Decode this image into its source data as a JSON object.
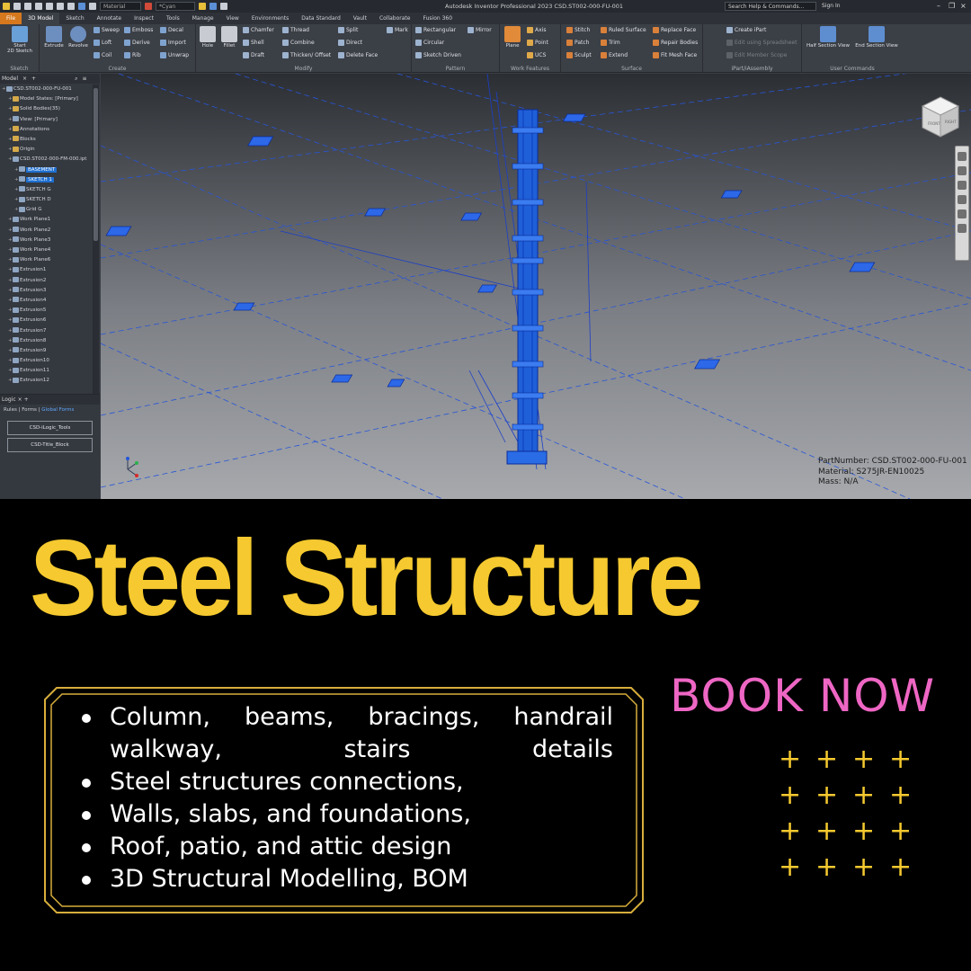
{
  "app": {
    "window_title": "Autodesk Inventor Professional 2023   CSD.ST002-000-FU-001",
    "material_field": "Material",
    "appearance_field": "*Cyan",
    "search_placeholder": "Search Help & Commands...",
    "sign_in": "Sign In",
    "tabs": [
      "File",
      "3D Model",
      "Sketch",
      "Annotate",
      "Inspect",
      "Tools",
      "Manage",
      "View",
      "Environments",
      "Data Standard",
      "Vault",
      "Collaborate",
      "Fusion 360"
    ],
    "active_tab": "3D Model",
    "ribbon": {
      "sketch": {
        "label": "Sketch",
        "start": "Start\n2D Sketch"
      },
      "create": {
        "label": "Create",
        "extrude": "Extrude",
        "revolve": "Revolve",
        "sweep": "Sweep",
        "loft": "Loft",
        "coil": "Coil",
        "emboss": "Emboss",
        "derive": "Derive",
        "rib": "Rib",
        "decal": "Decal",
        "import": "Import",
        "unwrap": "Unwrap"
      },
      "modify": {
        "label": "Modify",
        "hole": "Hole",
        "fillet": "Fillet",
        "chamfer": "Chamfer",
        "shell": "Shell",
        "draft": "Draft",
        "thread": "Thread",
        "combine": "Combine",
        "thicken": "Thicken/ Offset",
        "split": "Split",
        "direct": "Direct",
        "delete_face": "Delete Face"
      },
      "pattern": {
        "label": "Pattern",
        "mark": "Mark",
        "rectangular": "Rectangular",
        "circular": "Circular",
        "sketch_driven": "Sketch Driven",
        "mirror": "Mirror"
      },
      "work_features": {
        "label": "Work Features",
        "plane": "Plane",
        "axis": "Axis",
        "point": "Point",
        "ucs": "UCS"
      },
      "surface": {
        "label": "Surface",
        "stitch": "Stitch",
        "patch": "Patch",
        "sculpt": "Sculpt",
        "ruled": "Ruled Surface",
        "trim": "Trim",
        "extend": "Extend",
        "replace": "Replace Face",
        "repair": "Repair Bodies",
        "fit_mesh": "Fit Mesh Face"
      },
      "ipart": {
        "label": "iPart/iAssembly",
        "create": "Create iPart",
        "edit_spreadsheet": "Edit using Spreadsheet",
        "edit_member": "Edit Member Scope"
      },
      "user_commands": {
        "label": "User Commands",
        "half_section": "Half Section View",
        "end_section": "End Section View"
      }
    },
    "browser": {
      "tab": "Model",
      "items": [
        {
          "label": "CSD.ST002-000-FU-001",
          "level": 0,
          "icon": "part-icon"
        },
        {
          "label": "Model States: [Primary]",
          "level": 1,
          "icon": "folder-icon"
        },
        {
          "label": "Solid Bodies(35)",
          "level": 1,
          "icon": "folder-icon"
        },
        {
          "label": "View: [Primary]",
          "level": 1,
          "icon": "view-icon"
        },
        {
          "label": "Annotations",
          "level": 1,
          "icon": "folder-icon"
        },
        {
          "label": "Blocks",
          "level": 1,
          "icon": "folder-icon"
        },
        {
          "label": "Origin",
          "level": 1,
          "icon": "folder-icon"
        },
        {
          "label": "CSD.ST002-000-FM-000.ipt",
          "level": 1,
          "icon": "part-icon"
        },
        {
          "label": "BASEMENT",
          "level": 2,
          "icon": "sketch-icon",
          "selected": true
        },
        {
          "label": "SKETCH 1",
          "level": 2,
          "icon": "sketch-icon",
          "selected": true
        },
        {
          "label": "SKETCH G",
          "level": 2,
          "icon": "sketch-icon"
        },
        {
          "label": "SKETCH D",
          "level": 2,
          "icon": "sketch-icon"
        },
        {
          "label": "Grid G",
          "level": 2,
          "icon": "grid-icon"
        },
        {
          "label": "Work Plane1",
          "level": 1,
          "icon": "workplane-icon"
        },
        {
          "label": "Work Plane2",
          "level": 1,
          "icon": "workplane-icon"
        },
        {
          "label": "Work Plane3",
          "level": 1,
          "icon": "workplane-icon"
        },
        {
          "label": "Work Plane4",
          "level": 1,
          "icon": "workplane-icon"
        },
        {
          "label": "Work Plane6",
          "level": 1,
          "icon": "workplane-icon"
        },
        {
          "label": "Extrusion1",
          "level": 1,
          "icon": "extrusion-icon"
        },
        {
          "label": "Extrusion2",
          "level": 1,
          "icon": "extrusion-icon"
        },
        {
          "label": "Extrusion3",
          "level": 1,
          "icon": "extrusion-icon"
        },
        {
          "label": "Extrusion4",
          "level": 1,
          "icon": "extrusion-icon"
        },
        {
          "label": "Extrusion5",
          "level": 1,
          "icon": "extrusion-icon"
        },
        {
          "label": "Extrusion6",
          "level": 1,
          "icon": "extrusion-icon"
        },
        {
          "label": "Extrusion7",
          "level": 1,
          "icon": "extrusion-icon"
        },
        {
          "label": "Extrusion8",
          "level": 1,
          "icon": "extrusion-icon"
        },
        {
          "label": "Extrusion9",
          "level": 1,
          "icon": "extrusion-icon"
        },
        {
          "label": "Extrusion10",
          "level": 1,
          "icon": "extrusion-icon"
        },
        {
          "label": "Extrusion11",
          "level": 1,
          "icon": "extrusion-icon"
        },
        {
          "label": "Extrusion12",
          "level": 1,
          "icon": "extrusion-icon"
        }
      ]
    },
    "logic": {
      "tab": "Logic",
      "rules": "Rules",
      "forms": "Forms",
      "global_forms": "Global Forms",
      "buttons": [
        "CSD-iLogic_Tools",
        "CSD-Title_Block"
      ]
    },
    "properties": {
      "part_number": "PartNumber: CSD.ST002-000-FU-001",
      "material": "Material: S275JR-EN10025",
      "mass": "Mass: N/A"
    },
    "viewcube": {
      "front": "FRONT",
      "right": "RIGHT"
    }
  },
  "promo": {
    "headline": "Steel Structure",
    "cta": "BOOK NOW",
    "bullets": [
      "Column, beams, bracings, handrail walkway, stairs details",
      "Steel structures connections,",
      "Walls, slabs, and foundations,",
      "Roof, patio, and attic design",
      "3D Structural Modelling, BOM"
    ],
    "plus_symbols": [
      "+",
      "+",
      "+",
      "+",
      "+",
      "+",
      "+",
      "+",
      "+",
      "+",
      "+",
      "+",
      "+",
      "+",
      "+",
      "+"
    ]
  },
  "colors": {
    "headline": "#f5c92f",
    "cta": "#ee66c4",
    "frame": "#d8ae3c",
    "background": "#000000",
    "model_blue": "#1f5fd8",
    "file_tab": "#d6781e"
  }
}
